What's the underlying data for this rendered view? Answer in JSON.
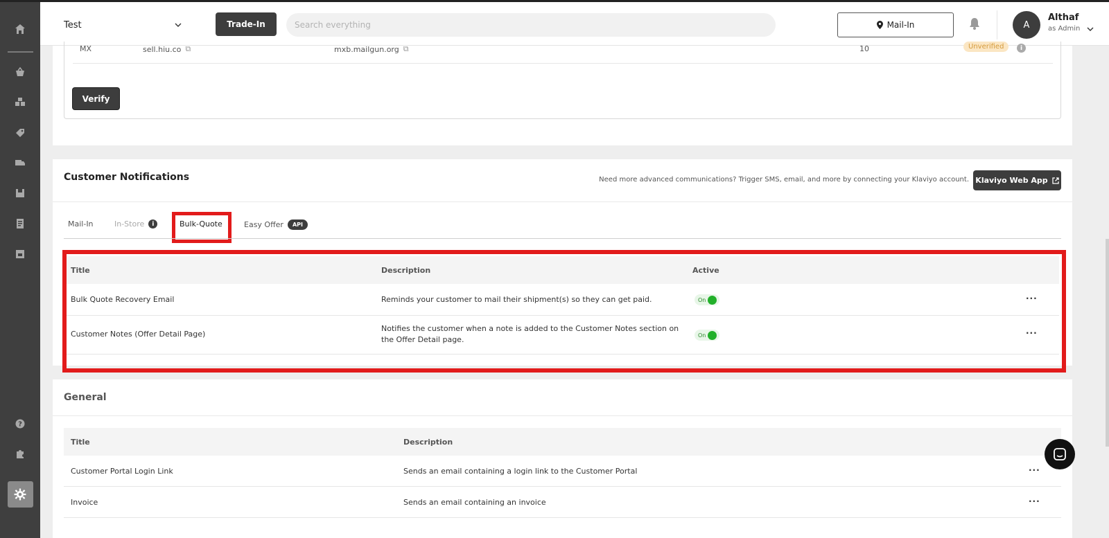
{
  "sidebar": {
    "icons": [
      "home-icon",
      "basket-icon",
      "boxes-icon",
      "pricing-icon",
      "shipping-icon",
      "inventory-icon",
      "invoice-icon",
      "store-icon",
      "help-icon",
      "puzzle-icon",
      "settings-icon"
    ]
  },
  "topbar": {
    "store_name": "Test",
    "tradein_label": "Trade-In",
    "search_placeholder": "Search everything",
    "mailin_label": "Mail-In",
    "user": {
      "initial": "A",
      "name": "Althaf",
      "role": "as Admin"
    }
  },
  "dns": {
    "row": {
      "type": "MX",
      "host": "sell.hiu.co",
      "value": "mxb.mailgun.org",
      "priority": "10",
      "status": "Unverified"
    },
    "verify_label": "Verify"
  },
  "customer_notifications": {
    "title": "Customer Notifications",
    "hint": "Need more advanced communications? Trigger SMS, email, and more by connecting your Klaviyo account.",
    "klaviyo_label": "Klaviyo Web App",
    "tabs": [
      {
        "label": "Mail-In"
      },
      {
        "label": "In-Store"
      },
      {
        "label": "Bulk-Quote"
      },
      {
        "label": "Easy Offer",
        "badge": "API"
      }
    ],
    "columns": {
      "title": "Title",
      "description": "Description",
      "active": "Active"
    },
    "rows": [
      {
        "title": "Bulk Quote Recovery Email",
        "description": "Reminds your customer to mail their shipment(s) so they can get paid.",
        "active": "On"
      },
      {
        "title": "Customer Notes (Offer Detail Page)",
        "description": "Notifies the customer when a note is added to the Customer Notes section on the Offer Detail page.",
        "active": "On"
      }
    ],
    "more_label": "···"
  },
  "general": {
    "title": "General",
    "columns": {
      "title": "Title",
      "description": "Description"
    },
    "rows": [
      {
        "title": "Customer Portal Login Link",
        "description": "Sends an email containing a login link to the Customer Portal"
      },
      {
        "title": "Invoice",
        "description": "Sends an email containing an invoice"
      }
    ]
  },
  "colors": {
    "accent": "#3d3d3d",
    "highlight": "#e21b1b",
    "toggle_on": "#22b02a",
    "warning_bg": "#fbe6c3"
  }
}
